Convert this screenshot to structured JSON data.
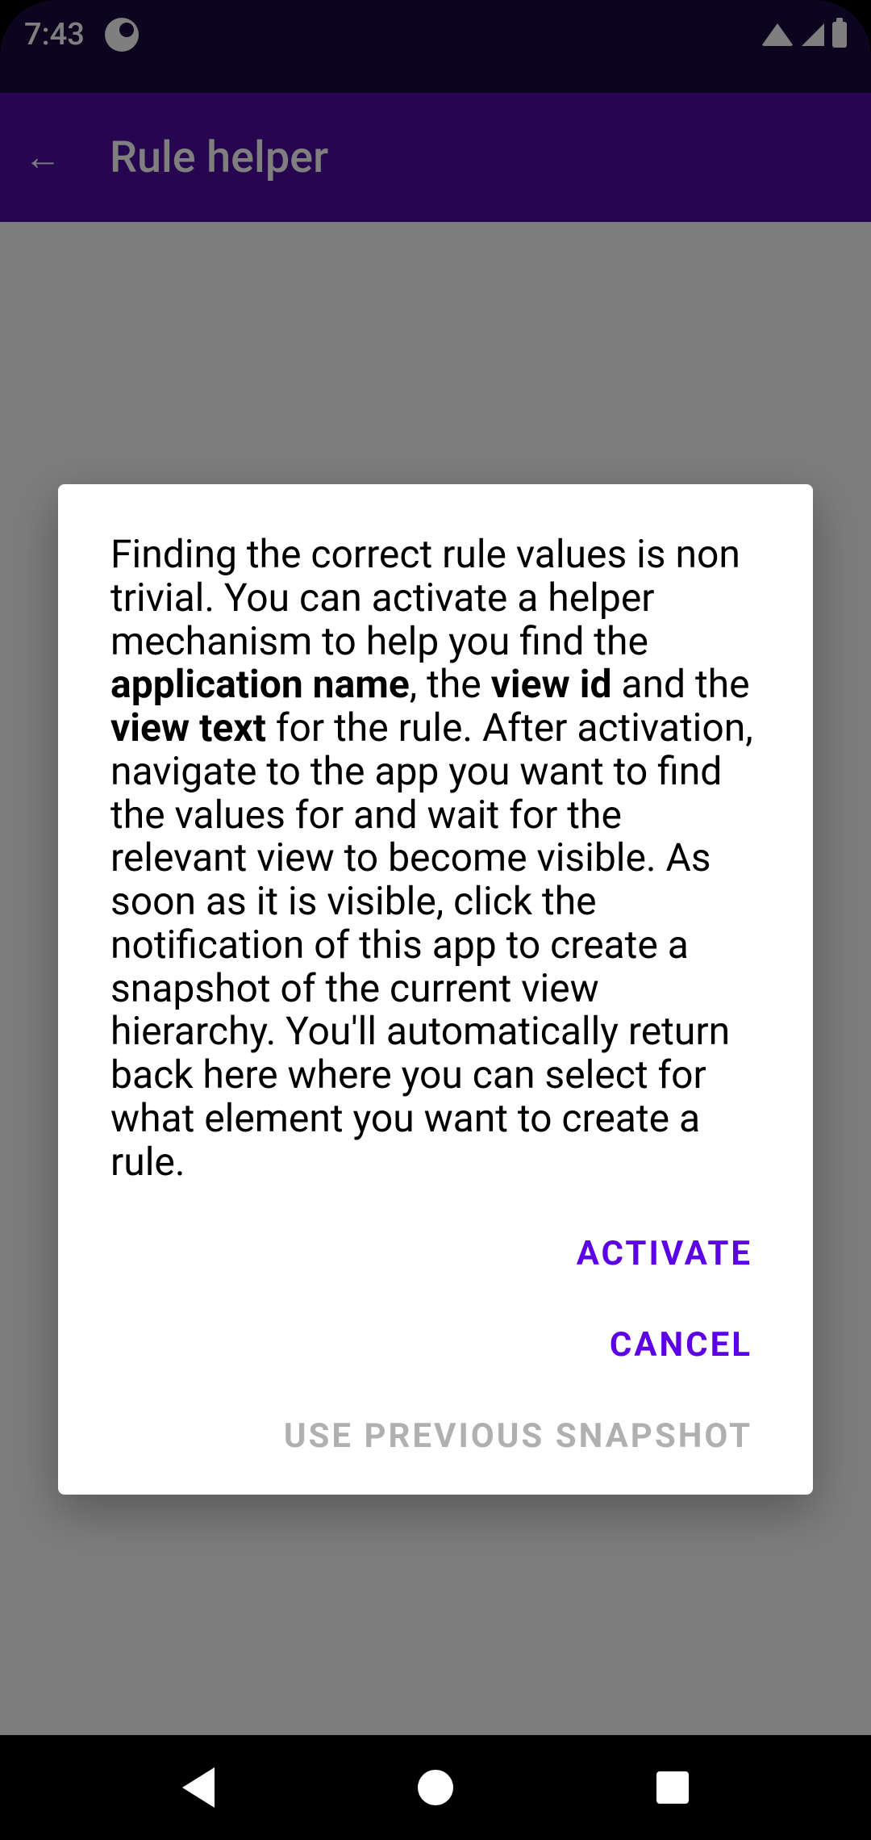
{
  "status": {
    "time": "7:43"
  },
  "appbar": {
    "title": "Rule helper"
  },
  "dialog": {
    "text_1": "Finding the correct rule values is non trivial. You can activate a helper mechanism to help you find the ",
    "bold_1": "application name",
    "text_2": ", the ",
    "bold_2": "view id",
    "text_3": " and the ",
    "bold_3": "view text",
    "text_4": " for the rule. After activation, navigate to the app you want to find the values for and wait for the relevant view to become visible. As soon as it is visible, click the notification of this app to create a snapshot of the current view hierarchy. You'll automatically return back here where you can select for what element you want to create a rule.",
    "activate_label": "ACTIVATE",
    "cancel_label": "CANCEL",
    "snapshot_label": "USE PREVIOUS SNAPSHOT"
  }
}
